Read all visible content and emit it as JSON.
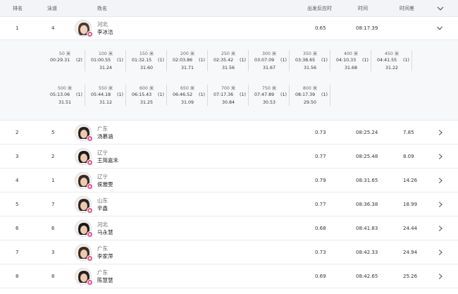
{
  "header": {
    "rank": "排名",
    "lane": "泳道",
    "name": "姓名",
    "reaction": "出发反应时",
    "time": "时间",
    "diff": "时间差"
  },
  "expanded_row": {
    "rank": "1",
    "lane": "4",
    "province": "河北",
    "name": "李冰洁",
    "reaction": "0.65",
    "time": "08:17.39",
    "diff": ""
  },
  "splits": [
    {
      "dist": "50 米",
      "time": "00:29.31",
      "rank": "(2)",
      "seg": ""
    },
    {
      "dist": "100 米",
      "time": "01:00.55",
      "rank": "(1)",
      "seg": "31.24"
    },
    {
      "dist": "150 米",
      "time": "01:32.15",
      "rank": "(1)",
      "seg": "31.60"
    },
    {
      "dist": "200 米",
      "time": "02:03.86",
      "rank": "(1)",
      "seg": "31.71"
    },
    {
      "dist": "250 米",
      "time": "02:35.42",
      "rank": "(1)",
      "seg": "31.56"
    },
    {
      "dist": "300 米",
      "time": "03:07.09",
      "rank": "(1)",
      "seg": "31.67"
    },
    {
      "dist": "350 米",
      "time": "03:38.65",
      "rank": "(1)",
      "seg": "31.56"
    },
    {
      "dist": "400 米",
      "time": "04:10.33",
      "rank": "(1)",
      "seg": "31.68"
    },
    {
      "dist": "450 米",
      "time": "04:41.55",
      "rank": "(1)",
      "seg": "31.22"
    },
    {
      "dist": "500 米",
      "time": "05:13.06",
      "rank": "(1)",
      "seg": "31.51"
    },
    {
      "dist": "550 米",
      "time": "05:44.18",
      "rank": "(1)",
      "seg": "31.12"
    },
    {
      "dist": "600 米",
      "time": "06:15.43",
      "rank": "(1)",
      "seg": "31.25"
    },
    {
      "dist": "650 米",
      "time": "06:46.52",
      "rank": "(1)",
      "seg": "31.09"
    },
    {
      "dist": "700 米",
      "time": "07:17.36",
      "rank": "(1)",
      "seg": "30.84"
    },
    {
      "dist": "750 米",
      "time": "07:47.89",
      "rank": "(1)",
      "seg": "30.53"
    },
    {
      "dist": "800 米",
      "time": "08:17.39",
      "rank": "(1)",
      "seg": "29.50"
    }
  ],
  "rows": [
    {
      "rank": "2",
      "lane": "5",
      "province": "广东",
      "name": "汤慕涵",
      "reaction": "0.73",
      "time": "08:25.24",
      "diff": "7.85"
    },
    {
      "rank": "3",
      "lane": "2",
      "province": "辽宁",
      "name": "王简嘉禾",
      "reaction": "0.77",
      "time": "08:25.48",
      "diff": "8.09"
    },
    {
      "rank": "4",
      "lane": "1",
      "province": "辽宁",
      "name": "侯雅雯",
      "reaction": "0.79",
      "time": "08:31.65",
      "diff": "14.26"
    },
    {
      "rank": "5",
      "lane": "7",
      "province": "山东",
      "name": "辛鑫",
      "reaction": "0.77",
      "time": "08:36.38",
      "diff": "18.99"
    },
    {
      "rank": "6",
      "lane": "6",
      "province": "河北",
      "name": "马永慧",
      "reaction": "0.68",
      "time": "08:41.83",
      "diff": "24.44"
    },
    {
      "rank": "7",
      "lane": "3",
      "province": "广东",
      "name": "李家萍",
      "reaction": "0.73",
      "time": "08:42.33",
      "diff": "24.94"
    },
    {
      "rank": "8",
      "lane": "8",
      "province": "广东",
      "name": "陈慧慧",
      "reaction": "0.69",
      "time": "08:42.65",
      "diff": "25.26"
    }
  ],
  "colors": {
    "header_bg": "#f2f4f8",
    "splits_bg": "#f7f8fa",
    "badge": "#e8548c",
    "text": "#333333"
  },
  "icons": {
    "collapse": "chevron-down-icon",
    "expand": "chevron-right-icon",
    "badge": "female-badge-icon"
  }
}
